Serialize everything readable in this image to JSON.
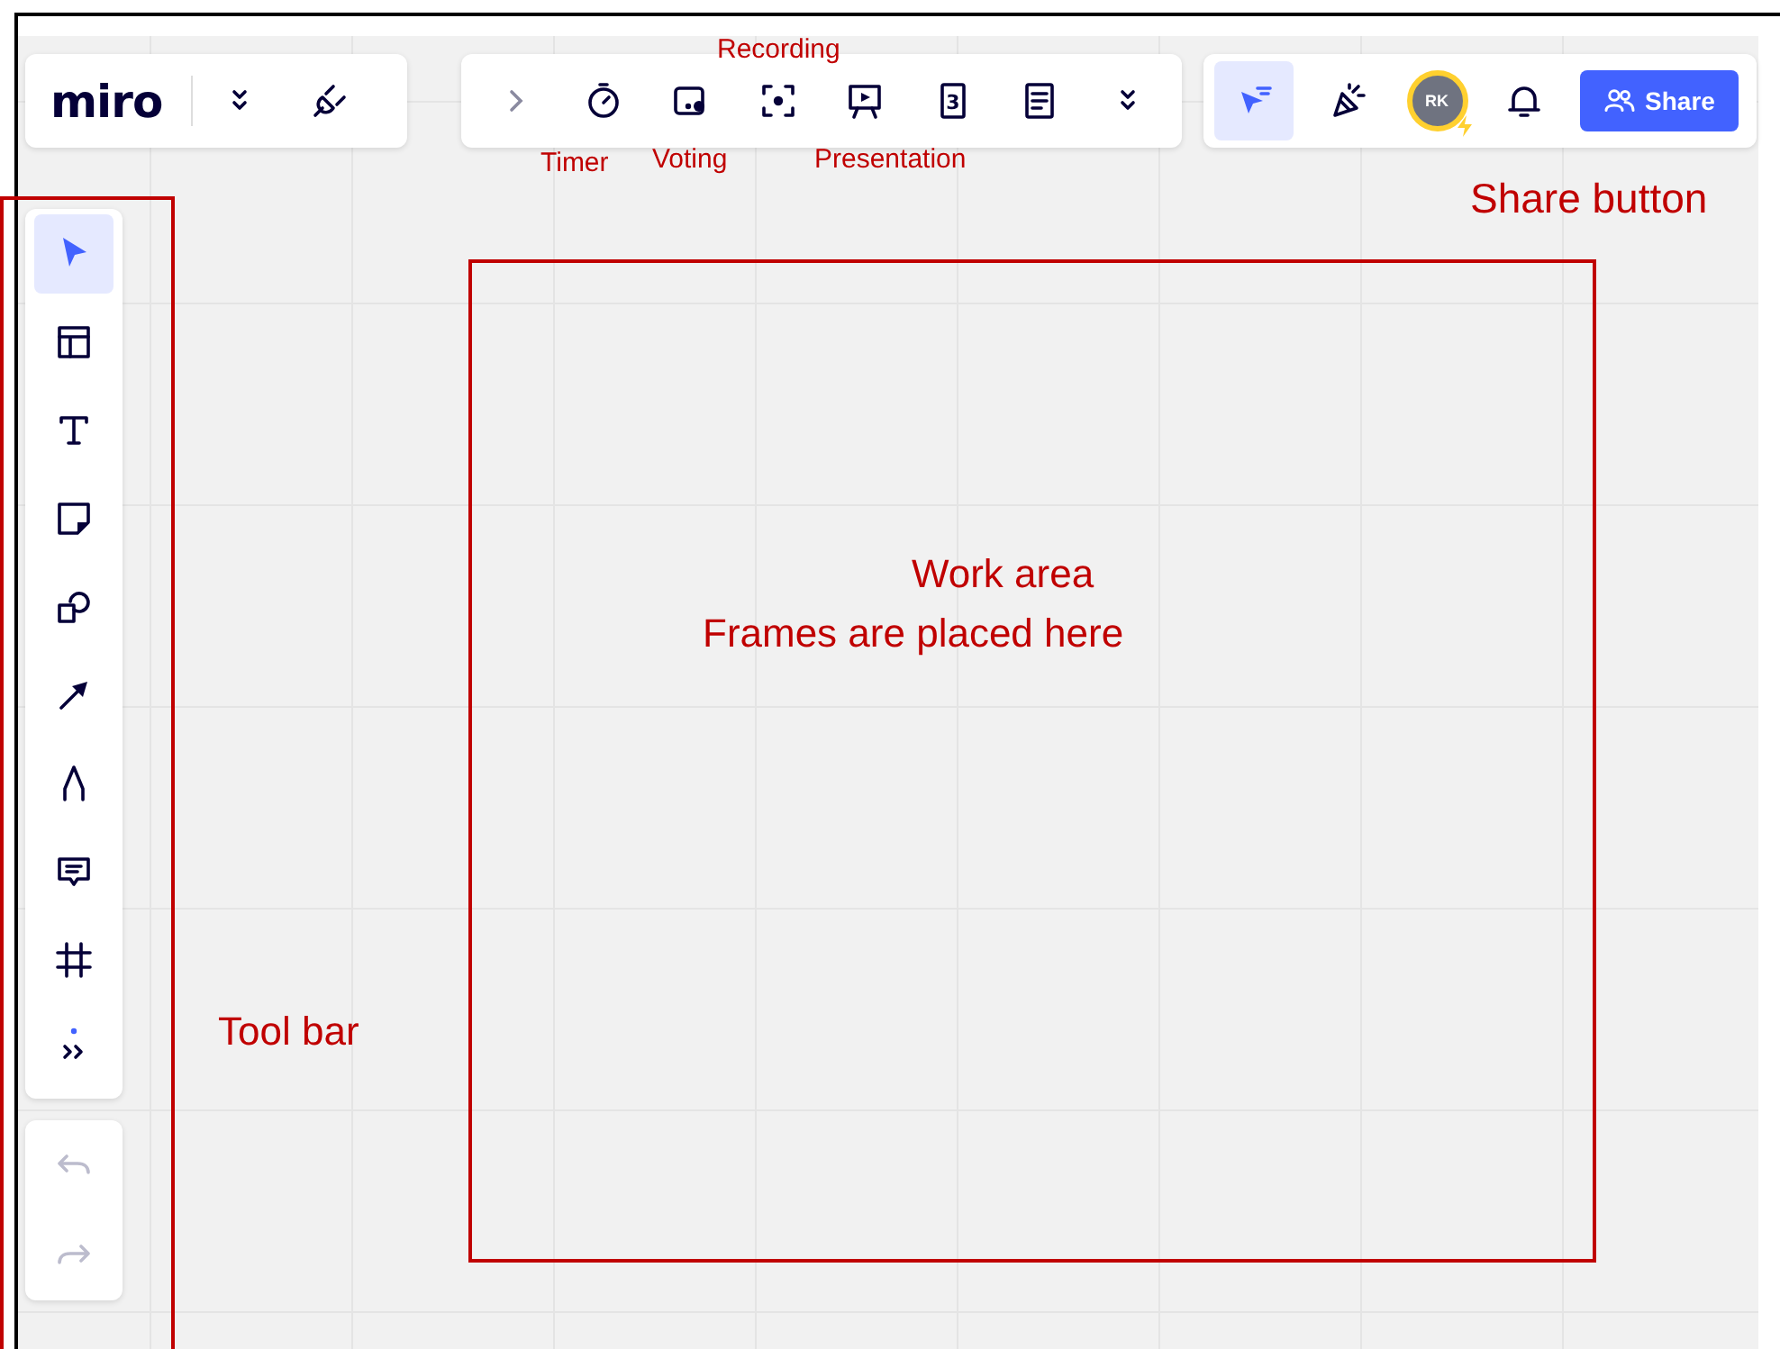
{
  "board_header": {
    "logo": "miro",
    "tools": [
      {
        "kind": "double-chevron"
      },
      {
        "kind": "plug"
      }
    ]
  },
  "apps_bar": [
    {
      "kind": "chevron-right"
    },
    {
      "kind": "timer"
    },
    {
      "kind": "voting"
    },
    {
      "kind": "recording"
    },
    {
      "kind": "presentation"
    },
    {
      "kind": "card",
      "label": "3"
    },
    {
      "kind": "notes"
    },
    {
      "kind": "double-chevron"
    }
  ],
  "collab_bar": {
    "items": [
      {
        "kind": "select-filter",
        "selected": true
      },
      {
        "kind": "party"
      },
      {
        "kind": "avatar",
        "initials": "RK"
      },
      {
        "kind": "bell"
      }
    ],
    "share_button": "Share"
  },
  "toolbar": [
    {
      "kind": "select",
      "selected": true
    },
    {
      "kind": "templates",
      "selected": false
    },
    {
      "kind": "text",
      "selected": false
    },
    {
      "kind": "sticky",
      "selected": false
    },
    {
      "kind": "shapes",
      "selected": false
    },
    {
      "kind": "arrow",
      "selected": false
    },
    {
      "kind": "pen",
      "selected": false
    },
    {
      "kind": "comment",
      "selected": false
    },
    {
      "kind": "frame",
      "selected": false
    },
    {
      "kind": "more",
      "selected": false
    }
  ],
  "history": [
    {
      "kind": "undo",
      "disabled": true
    },
    {
      "kind": "redo",
      "disabled": true
    }
  ],
  "annotations": [
    {
      "kind": "recording",
      "text": "Recording"
    },
    {
      "kind": "timer",
      "text": "Timer"
    },
    {
      "kind": "voting",
      "text": "Voting"
    },
    {
      "kind": "presentation",
      "text": "Presentation"
    },
    {
      "kind": "share",
      "text": "Share button"
    },
    {
      "kind": "work-title",
      "text": "Work area"
    },
    {
      "kind": "work-sub",
      "text": "Frames are placed here"
    },
    {
      "kind": "toolbar",
      "text": "Tool bar"
    }
  ]
}
